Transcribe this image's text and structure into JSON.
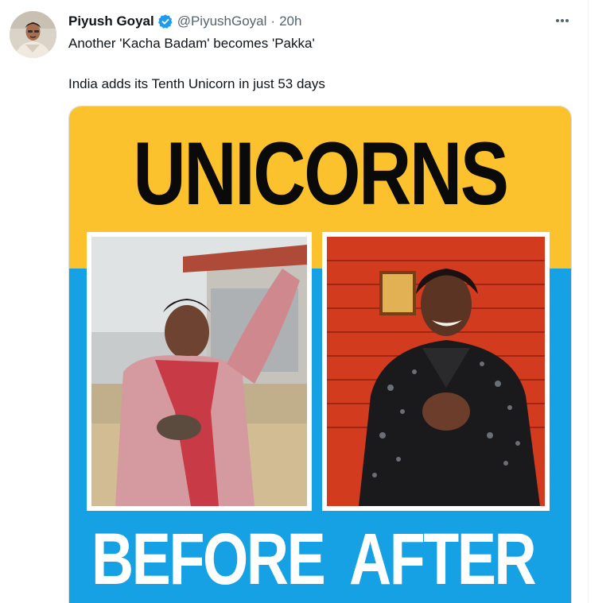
{
  "tweet": {
    "author_name": "Piyush Goyal",
    "handle": "@PiyushGoyal",
    "separator": "·",
    "time": "20h",
    "text_line1": "Another 'Kacha Badam' becomes 'Pakka'",
    "text_line2": "India adds its Tenth Unicorn in just 53 days",
    "verified": true
  },
  "media": {
    "title": "UNICORNS",
    "left_label": "BEFORE",
    "right_label": "AFTER",
    "colors": {
      "top_band": "#fcc22d",
      "bottom_band": "#15a1e3",
      "title_text": "#0a0a0a",
      "label_text": "#ffffff"
    }
  },
  "icons": {
    "verified": "verified-badge-icon",
    "more": "more-options-icon"
  },
  "colors": {
    "name": "#0f1419",
    "secondary": "#536471",
    "verified": "#1d9bf0"
  }
}
